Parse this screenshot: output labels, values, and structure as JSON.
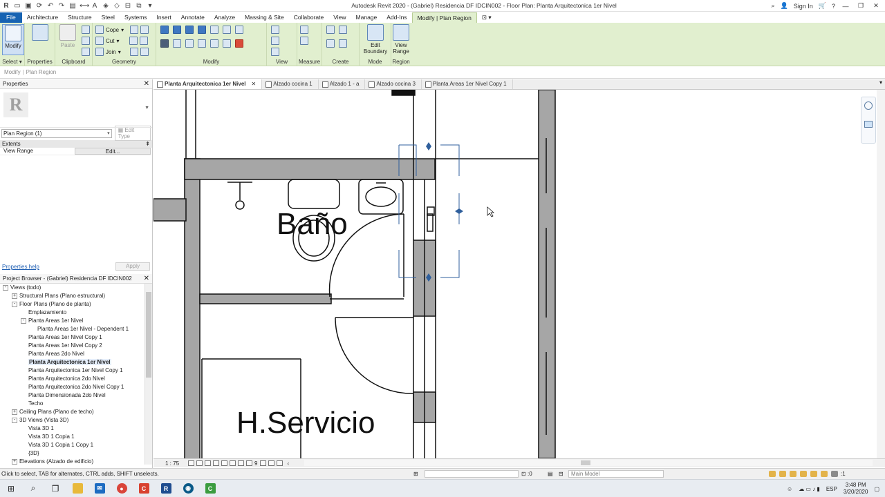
{
  "titlebar": {
    "title": "Autodesk Revit 2020 - (Gabriel) Residencia DF IDCIN002 - Floor Plan: Planta Arquitectonica 1er Nivel",
    "sign_in": "Sign In"
  },
  "menu": {
    "tabs": [
      "File",
      "Architecture",
      "Structure",
      "Steel",
      "Systems",
      "Insert",
      "Annotate",
      "Analyze",
      "Massing & Site",
      "Collaborate",
      "View",
      "Manage",
      "Add-Ins",
      "Modify | Plan Region"
    ]
  },
  "ribbon": {
    "modify_label": "Modify",
    "paste_label": "Paste",
    "cope_label": "Cope",
    "cut_label": "Cut",
    "join_label": "Join",
    "edit_boundary_label": "Edit Boundary",
    "view_range_label": "View Range",
    "panels": {
      "select": "Select",
      "properties": "Properties",
      "clipboard": "Clipboard",
      "geometry": "Geometry",
      "modify": "Modify",
      "view": "View",
      "measure": "Measure",
      "create": "Create",
      "mode": "Mode",
      "region": "Region"
    }
  },
  "contextbar": {
    "part1": "Modify",
    "part2": "Plan Region"
  },
  "properties": {
    "title": "Properties",
    "type_selector": "Plan Region (1)",
    "edit_type": "Edit Type",
    "group": "Extents",
    "rows": [
      {
        "key": "View Range",
        "value": "Edit..."
      }
    ],
    "help": "Properties help",
    "apply": "Apply"
  },
  "project_browser": {
    "title": "Project Browser - (Gabriel) Residencia DF IDCIN002",
    "tree": [
      {
        "label": "Views (todo)",
        "level": 0,
        "toggle": "-"
      },
      {
        "label": "Structural Plans (Plano estructural)",
        "level": 1,
        "toggle": "+"
      },
      {
        "label": "Floor Plans (Plano de planta)",
        "level": 1,
        "toggle": "-"
      },
      {
        "label": "Emplazamiento",
        "level": 2,
        "toggle": ""
      },
      {
        "label": "Planta Areas 1er Nivel",
        "level": 2,
        "toggle": "-"
      },
      {
        "label": "Planta Areas 1er Nivel - Dependent 1",
        "level": 3,
        "toggle": ""
      },
      {
        "label": "Planta Areas 1er Nivel Copy 1",
        "level": 2,
        "toggle": ""
      },
      {
        "label": "Planta Areas 1er Nivel Copy 2",
        "level": 2,
        "toggle": ""
      },
      {
        "label": "Planta Areas 2do Nivel",
        "level": 2,
        "toggle": ""
      },
      {
        "label": "Planta Arquitectonica 1er Nivel",
        "level": 2,
        "toggle": "",
        "active": true
      },
      {
        "label": "Planta Arquitectonica 1er Nivel Copy 1",
        "level": 2,
        "toggle": ""
      },
      {
        "label": "Planta Arquitectonica 2do Nivel",
        "level": 2,
        "toggle": ""
      },
      {
        "label": "Planta Arquitectonica 2do Nivel Copy 1",
        "level": 2,
        "toggle": ""
      },
      {
        "label": "Planta Dimensionada 2do Nivel",
        "level": 2,
        "toggle": ""
      },
      {
        "label": "Techo",
        "level": 2,
        "toggle": ""
      },
      {
        "label": "Ceiling Plans (Plano de techo)",
        "level": 1,
        "toggle": "+"
      },
      {
        "label": "3D Views (Vista 3D)",
        "level": 1,
        "toggle": "-"
      },
      {
        "label": "Vista 3D 1",
        "level": 2,
        "toggle": ""
      },
      {
        "label": "Vista 3D 1 Copia 1",
        "level": 2,
        "toggle": ""
      },
      {
        "label": "Vista 3D 1 Copia 1 Copy 1",
        "level": 2,
        "toggle": ""
      },
      {
        "label": "{3D}",
        "level": 2,
        "toggle": ""
      },
      {
        "label": "Elevations (Alzado de edificio)",
        "level": 1,
        "toggle": "+"
      }
    ]
  },
  "doc_tabs": [
    {
      "label": "Planta Arquitectonica 1er Nivel",
      "active": true
    },
    {
      "label": "Alzado cocina 1",
      "active": false
    },
    {
      "label": "Alzado 1 - a",
      "active": false
    },
    {
      "label": "Alzado cocina 3",
      "active": false
    },
    {
      "label": "Planta Areas 1er Nivel Copy 1",
      "active": false
    }
  ],
  "canvas": {
    "room1": "Baño",
    "room2": "H.Servicio"
  },
  "viewbar": {
    "scale": "1 : 75",
    "hidden_count": "9"
  },
  "statusbar": {
    "message": "Click to select, TAB for alternates, CTRL adds, SHIFT unselects.",
    "count": ":0",
    "model": "Main Model",
    "filter_count": ":1"
  },
  "taskbar": {
    "language": "ESP",
    "time": "3:48 PM",
    "date": "3/20/2020"
  },
  "colors": {
    "file_tab": "#1763b2",
    "ribbon_bg": "#e1efcf",
    "wall_fill": "#a6a6a6",
    "selection": "#2f5f9c"
  }
}
